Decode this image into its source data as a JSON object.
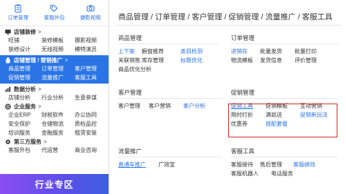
{
  "sidebar": {
    "top_tabs": [
      {
        "label": "订单管理",
        "icon": "clipboard-icon"
      },
      {
        "label": "客服外包",
        "icon": "tag-icon"
      },
      {
        "label": "摄影视频",
        "icon": "camera-icon"
      }
    ],
    "sections": [
      {
        "title": "店铺装修",
        "icon": "monitor-icon",
        "arrow": ">",
        "rows": [
          [
            "旺铺",
            "装修模板",
            "摄影视频"
          ],
          [
            "装修设计",
            "无线视频",
            "模特演员"
          ]
        ]
      },
      {
        "title": "店铺管理 / 营销推广",
        "icon": "bag-icon",
        "arrow": ">",
        "active": true,
        "rows": [
          [
            "商品管理",
            "订单管理",
            "客户管理"
          ],
          [
            "促销管理",
            "流量推广",
            "客服工具"
          ]
        ]
      },
      {
        "title": "数据分析",
        "icon": "chart-icon",
        "arrow": ">",
        "rows": [
          [
            "店铺分析",
            "行业分析",
            "生意参谋"
          ]
        ]
      },
      {
        "title": "企业服务",
        "icon": "globe-icon",
        "arrow": ">",
        "rows": [
          [
            "企业ERP",
            "财税软件",
            "办公协同"
          ],
          [
            "安全保护",
            "仓储物流",
            "质检品控"
          ],
          [
            "培训服务",
            "金融服务",
            "租赁安装"
          ]
        ]
      },
      {
        "title": "第三方服务",
        "icon": "gear-icon",
        "arrow": ">",
        "rows": [
          [
            "客服外包",
            "代运营",
            "商业咨询"
          ]
        ]
      }
    ],
    "promo_label": "行业专区"
  },
  "main": {
    "breadcrumb": "商品管理 / 订单管理 / 客户管理 / 促销管理 / 流量推广 / 客服工具",
    "cards": {
      "product": {
        "title": "商品管理",
        "rows": [
          [
            "上下架",
            "橱窗推荐",
            "类目检测"
          ],
          [
            "关联销售",
            "库存管理",
            "标题优化"
          ],
          [
            "商品优化分析"
          ]
        ]
      },
      "order": {
        "title": "订单管理",
        "rows": [
          [
            "进销存",
            "批量发货",
            "批量打印"
          ],
          [
            "物流模板",
            "发货信息",
            "评价管理"
          ]
        ]
      },
      "customer": {
        "title": "客户管理",
        "rows": [
          [
            "客户管理",
            "客户营销",
            "客户分析"
          ]
        ]
      },
      "promotion": {
        "title": "促销管理",
        "rows": [
          [
            "促销工具",
            "促销模板",
            "互动营销"
          ],
          [
            "限时打折",
            "满就送",
            "促销新玩法"
          ],
          [
            "优惠券",
            "搭配套餐"
          ]
        ]
      },
      "traffic": {
        "title": "流量推广",
        "rows": [
          [
            "直通车推广",
            "广效宝"
          ]
        ]
      },
      "service": {
        "title": "客服工具",
        "rows": [
          [
            "客服接待",
            "售后管理",
            "客服绩效"
          ],
          [
            "客服机器人",
            "电话服务"
          ]
        ]
      }
    }
  },
  "colors": {
    "accent": "#2a74e6",
    "highlight": "#e02020",
    "promo_start": "#8a4df2",
    "promo_end": "#3b5fe0"
  }
}
